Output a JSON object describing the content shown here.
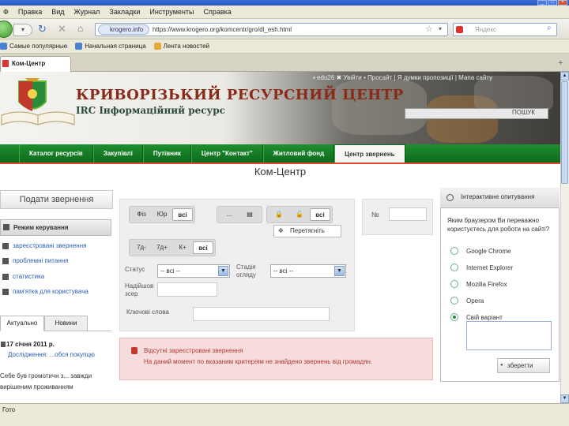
{
  "window": {
    "title_partial": "...",
    "controls": [
      "_",
      "□",
      "×"
    ]
  },
  "menu": [
    "Ф",
    "Правка",
    "Вид",
    "Журнал",
    "Закладки",
    "Инструменты",
    "Справка"
  ],
  "navbar": {
    "site_badge": "krogero.info",
    "url": "https://www.krogero.org/komcentr/gro/dl_esh.html",
    "search_placeholder": "Яндекс"
  },
  "bookmarks": [
    "Самые популярные",
    "Начальная страница",
    "Лента новостей"
  ],
  "tab": {
    "label": "Ком-Центр",
    "new_tab": "+"
  },
  "header": {
    "title": "КРИВОРІЗЬКИЙ РЕСУРСНИЙ ЦЕНТР",
    "subtitle": "IRC Інформаційний ресурс",
    "toplinks": "▪ edu26  ✖ Увійти  ▪ Просайт  | Я думки пропозиції | Мапа сайту",
    "search_button": "ПОШУК"
  },
  "nav": [
    {
      "label": "Каталог ресурсів",
      "active": false
    },
    {
      "label": "Закупівлі",
      "active": false
    },
    {
      "label": "Путівник",
      "active": false
    },
    {
      "label": "Центр \"Контакт\"",
      "active": false
    },
    {
      "label": "Житловий фонд",
      "active": false
    },
    {
      "label": "Центр звернень",
      "active": true
    }
  ],
  "page_title": "Ком-Центр",
  "left": {
    "submit_button": "Подати звернення",
    "modes_title": "Режим керування",
    "links": [
      "зареєстровані звернення",
      "проблемні питання",
      "статистика",
      "пам'ятка для користувача"
    ],
    "news_tabs": [
      "Актуально",
      "Новини"
    ],
    "news": {
      "date": "17 січня 2011 р.",
      "line1": "Дослідження: ...обся покупцю",
      "line2": "Себе був громотичн з... завжди",
      "line3": "вирішеним проживанням"
    }
  },
  "filters": {
    "group1": [
      "Фіз",
      "Юр",
      "всі"
    ],
    "group1_selected": "всі",
    "group2": [
      "...",
      "▤"
    ],
    "group3": [
      "🔒",
      "🔓",
      "всі"
    ],
    "group3_selected": "всі",
    "group4": [
      "7д-",
      "7д+",
      "К+",
      "всі"
    ],
    "group4_selected": "всі",
    "move_button": "Перетягніть",
    "status_label": "Статус",
    "status_value": "-- всі --",
    "review_label": "Стадія огляду",
    "review_value": "-- всі --",
    "date_label": "Надійшов зсер",
    "keywords_label": "Ключові слова"
  },
  "number": {
    "label": "№"
  },
  "alert": {
    "title": "Відсутні зареєстровані звернення",
    "text": "На даний момент по вказаним критеріям не знайдено звернень від громадян."
  },
  "poll": {
    "title": "Інтерактивне опитування",
    "question": "Яким браузером Ви переважно користуєтесь для роботи на сайті?",
    "options": [
      {
        "label": "Google Chrome",
        "selected": false
      },
      {
        "label": "Internet Explorer",
        "selected": false
      },
      {
        "label": "Mozilla Firefox",
        "selected": false
      },
      {
        "label": "Opera",
        "selected": false
      },
      {
        "label": "Свій варіант",
        "selected": true
      }
    ],
    "save_button": "зберегти"
  },
  "status_bar": "Гото",
  "colors": {
    "nav_green": "#1e8f2e",
    "accent_red": "#e04a2a",
    "title_brown": "#8a2a18",
    "alert_text": "#b03a2e"
  }
}
